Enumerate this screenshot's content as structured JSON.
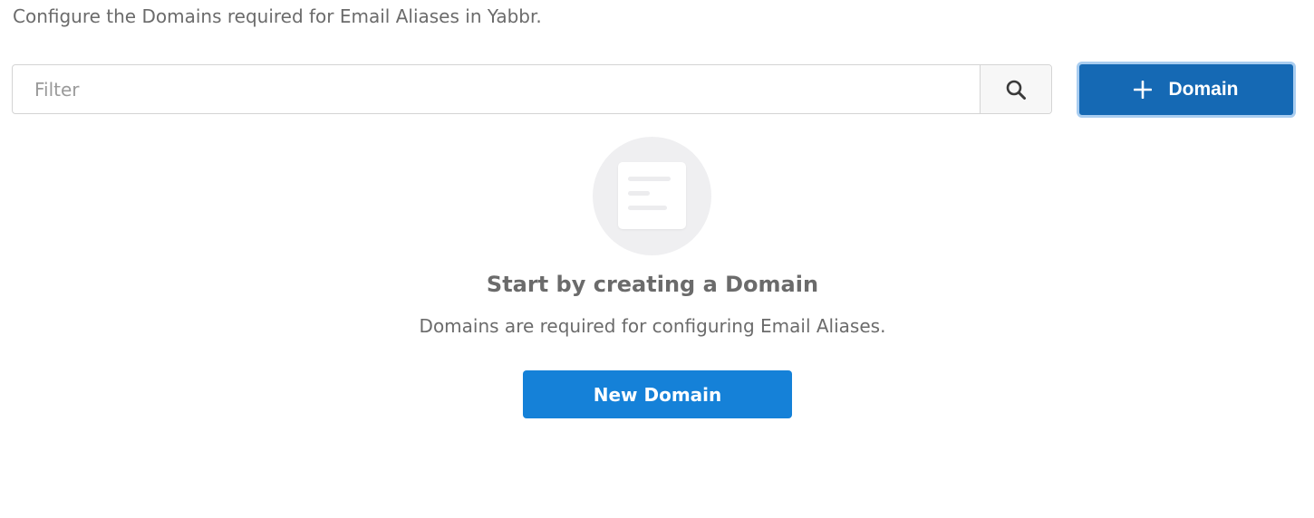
{
  "header": {
    "description": "Configure the Domains required for Email Aliases in Yabbr."
  },
  "filter": {
    "placeholder": "Filter",
    "value": "",
    "search_icon": "search-icon"
  },
  "add_button": {
    "icon": "plus-icon",
    "label": "Domain",
    "bg_color": "#1569b4"
  },
  "empty_state": {
    "illustration_icon": "document-icon",
    "title": "Start by creating a Domain",
    "subtitle": "Domains are required for configuring Email Aliases.",
    "button_label": "New Domain",
    "button_color": "#1581d8"
  }
}
